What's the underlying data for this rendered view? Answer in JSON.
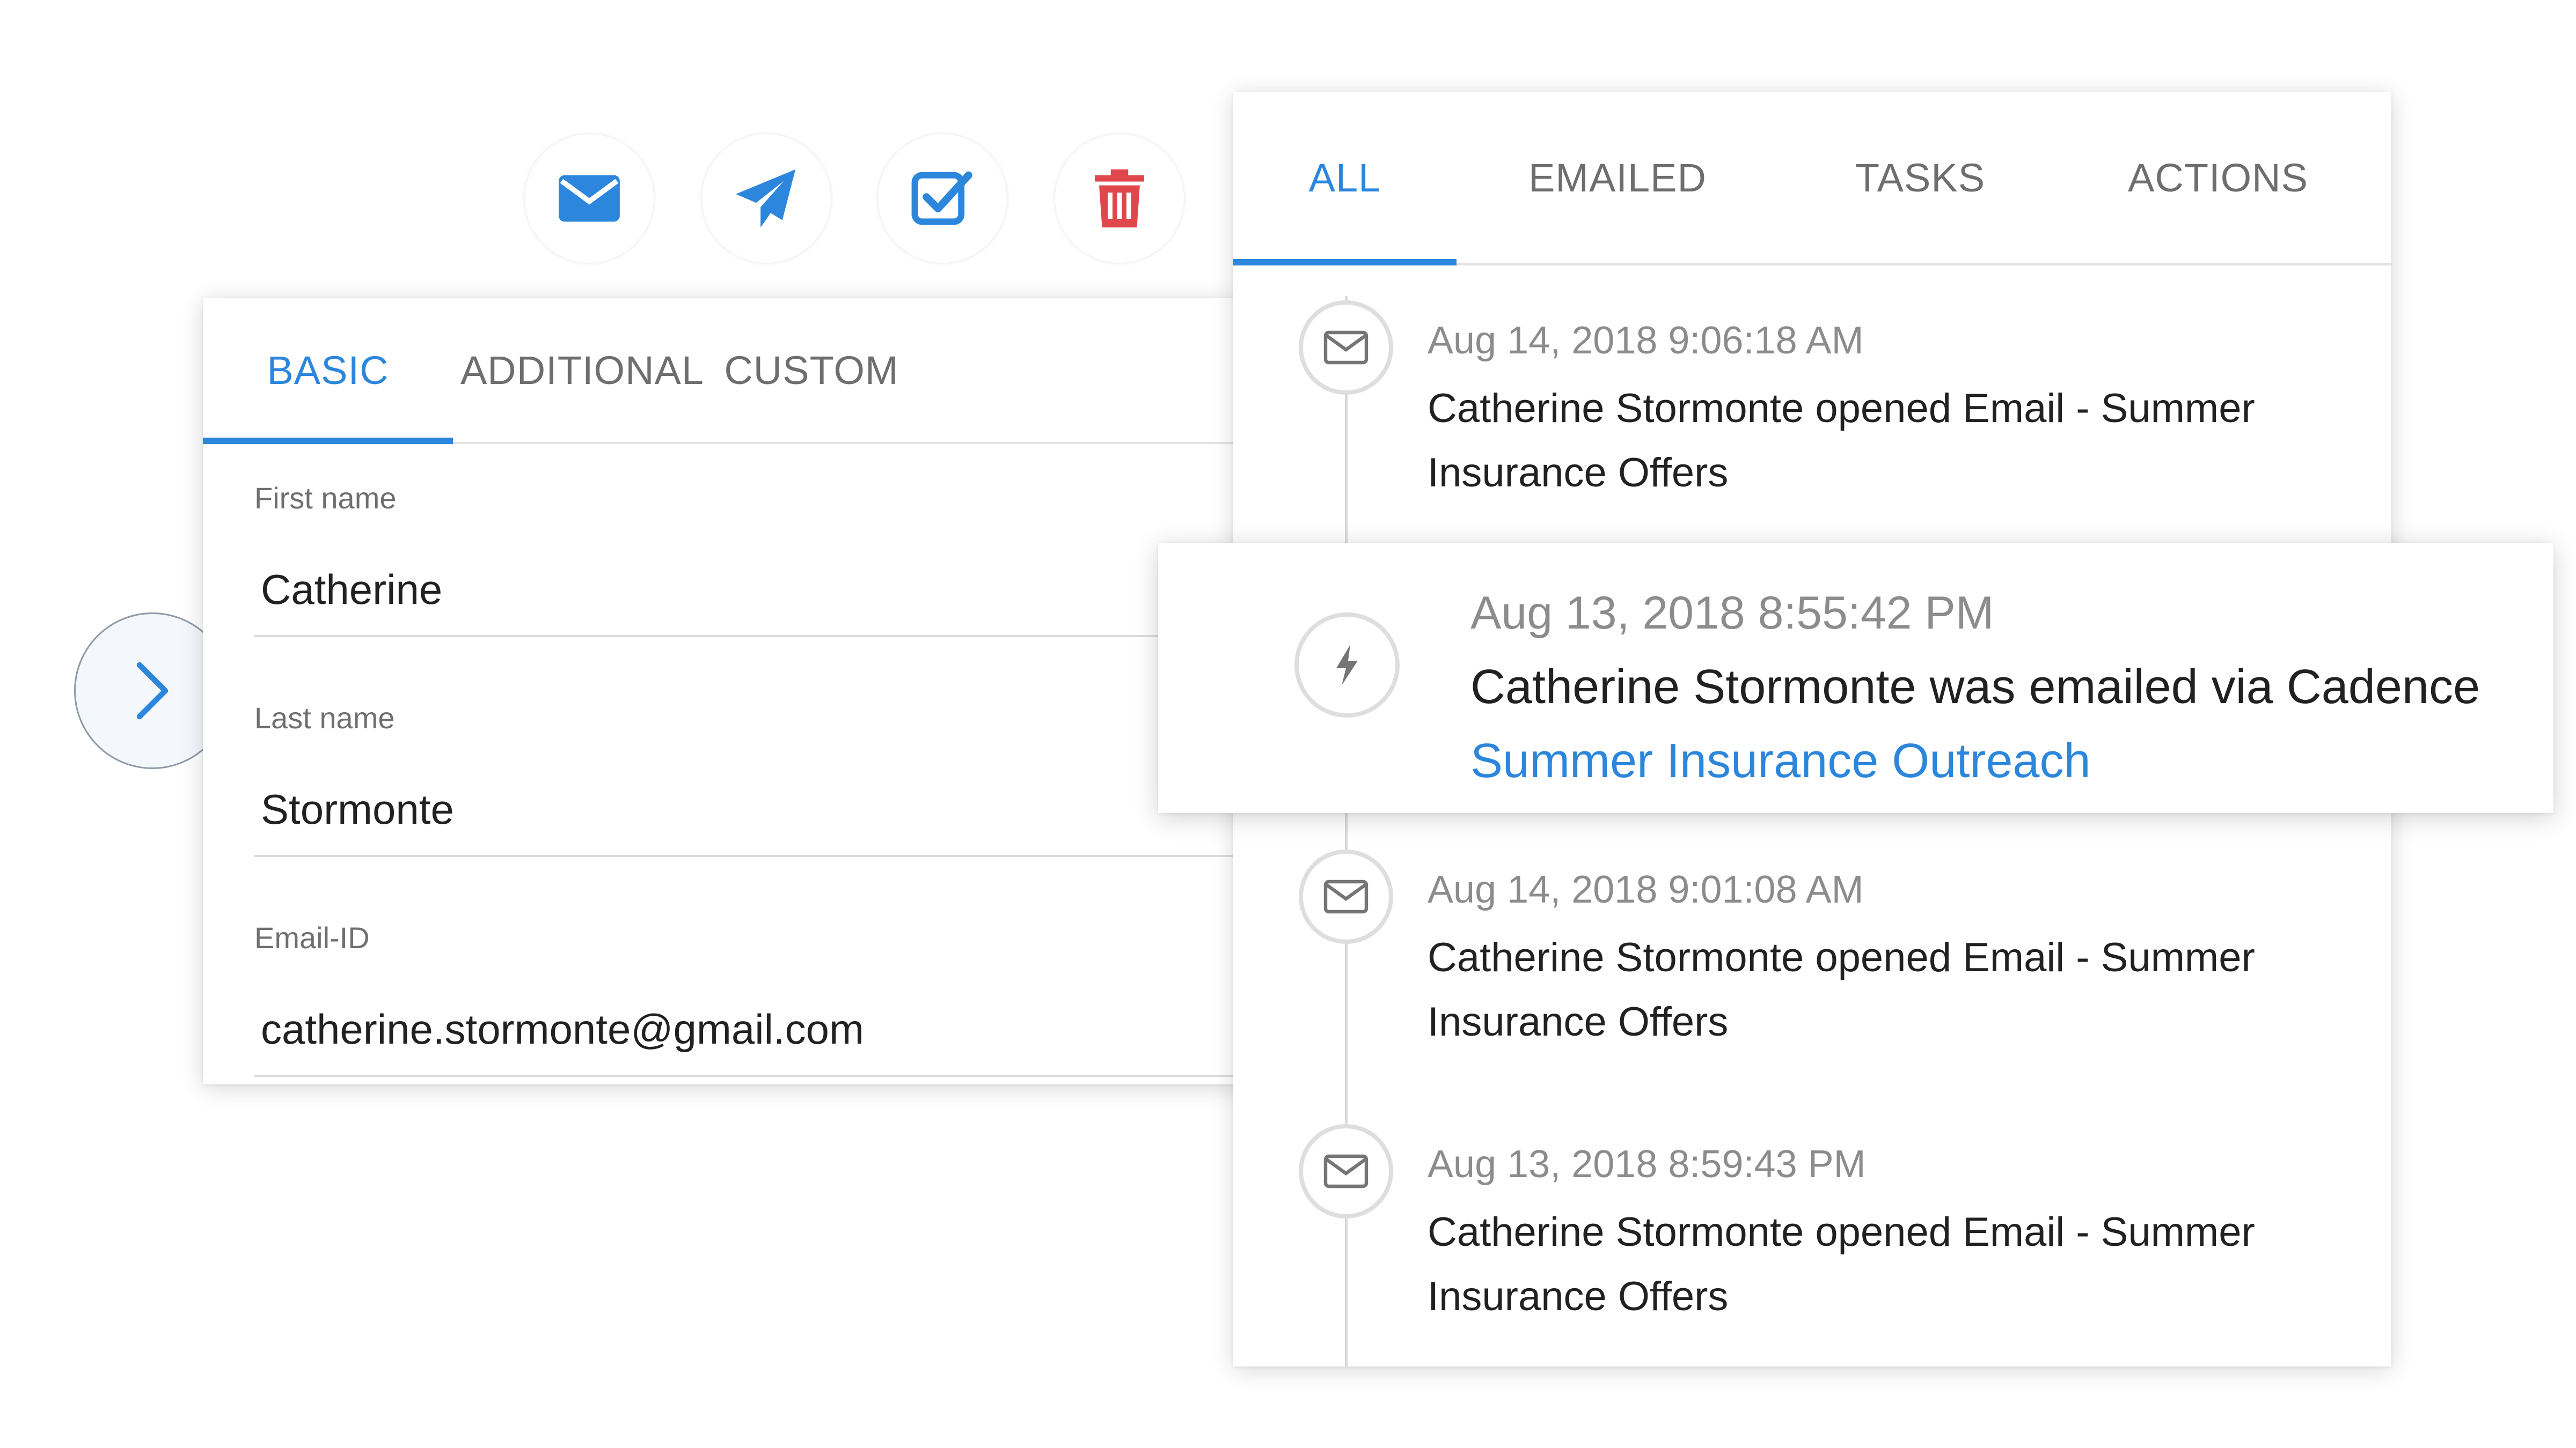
{
  "actions": {
    "email_icon": "envelope-icon",
    "send_icon": "paper-plane-icon",
    "task_icon": "checkbox-icon",
    "delete_icon": "trash-icon"
  },
  "contact_form": {
    "tabs": [
      {
        "label": "BASIC",
        "active": true
      },
      {
        "label": "ADDITIONAL",
        "active": false
      },
      {
        "label": "CUSTOM",
        "active": false
      }
    ],
    "fields": [
      {
        "label": "First name",
        "value": "Catherine"
      },
      {
        "label": "Last name",
        "value": "Stormonte"
      },
      {
        "label": "Email-ID",
        "value": "catherine.stormonte@gmail.com"
      }
    ]
  },
  "activity": {
    "tabs": [
      {
        "label": "ALL",
        "active": true
      },
      {
        "label": "EMAILED",
        "active": false
      },
      {
        "label": "TASKS",
        "active": false
      },
      {
        "label": "ACTIONS",
        "active": false
      }
    ],
    "items": [
      {
        "icon": "envelope-icon",
        "date": "Aug 14, 2018 9:06:18 AM",
        "line1": "Catherine Stormonte opened Email - Summer",
        "line2": "Insurance Offers"
      },
      {
        "icon": "envelope-icon",
        "date": "Aug 14, 2018 9:01:08 AM",
        "line1": "Catherine Stormonte opened Email - Summer",
        "line2": "Insurance Offers"
      },
      {
        "icon": "envelope-icon",
        "date": "Aug 13, 2018 8:59:43 PM",
        "line1": "Catherine Stormonte opened Email - Summer",
        "line2": "Insurance Offers"
      }
    ],
    "highlighted": {
      "icon": "lightning-icon",
      "date": "Aug 13, 2018 8:55:42 PM",
      "text": "Catherine Stormonte was emailed via Cadence",
      "link": "Summer Insurance Outreach"
    }
  },
  "colors": {
    "accent": "#2c86dc",
    "delete": "#e0474c",
    "muted_text": "#8c8c8c"
  }
}
